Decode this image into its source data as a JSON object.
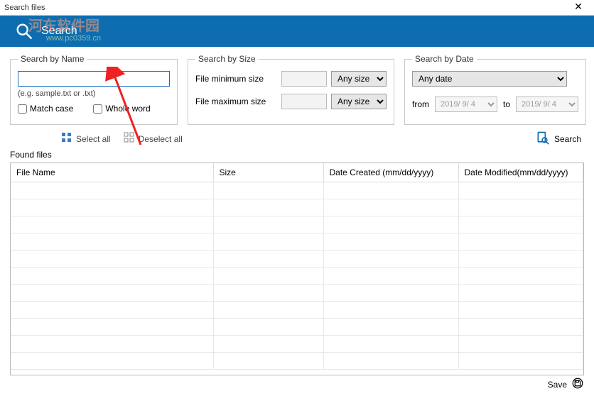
{
  "window": {
    "title": "Search files"
  },
  "header": {
    "label": "Search"
  },
  "watermark": {
    "line1": "河东软件园",
    "line2": "www.pc0359.cn"
  },
  "searchName": {
    "legend": "Search by Name",
    "value": "",
    "hint": "(e.g. sample.txt or .txt)",
    "matchCaseLabel": "Match case",
    "wholeWordLabel": "Whole word"
  },
  "searchSize": {
    "legend": "Search by Size",
    "minLabel": "File minimum size",
    "maxLabel": "File maximum size",
    "minValue": "",
    "maxValue": "",
    "minUnit": "Any size",
    "maxUnit": "Any size"
  },
  "searchDate": {
    "legend": "Search by Date",
    "option": "Any date",
    "fromLabel": "from",
    "toLabel": "to",
    "fromValue": "2019/ 9/ 4",
    "toValue": "2019/ 9/ 4"
  },
  "toolbar": {
    "selectAll": "Select all",
    "deselectAll": "Deselect all",
    "searchBtn": "Search"
  },
  "grid": {
    "foundLabel": "Found files",
    "cols": [
      "File Name",
      "Size",
      "Date Created (mm/dd/yyyy)",
      "Date Modified(mm/dd/yyyy)"
    ]
  },
  "footer": {
    "save": "Save"
  }
}
